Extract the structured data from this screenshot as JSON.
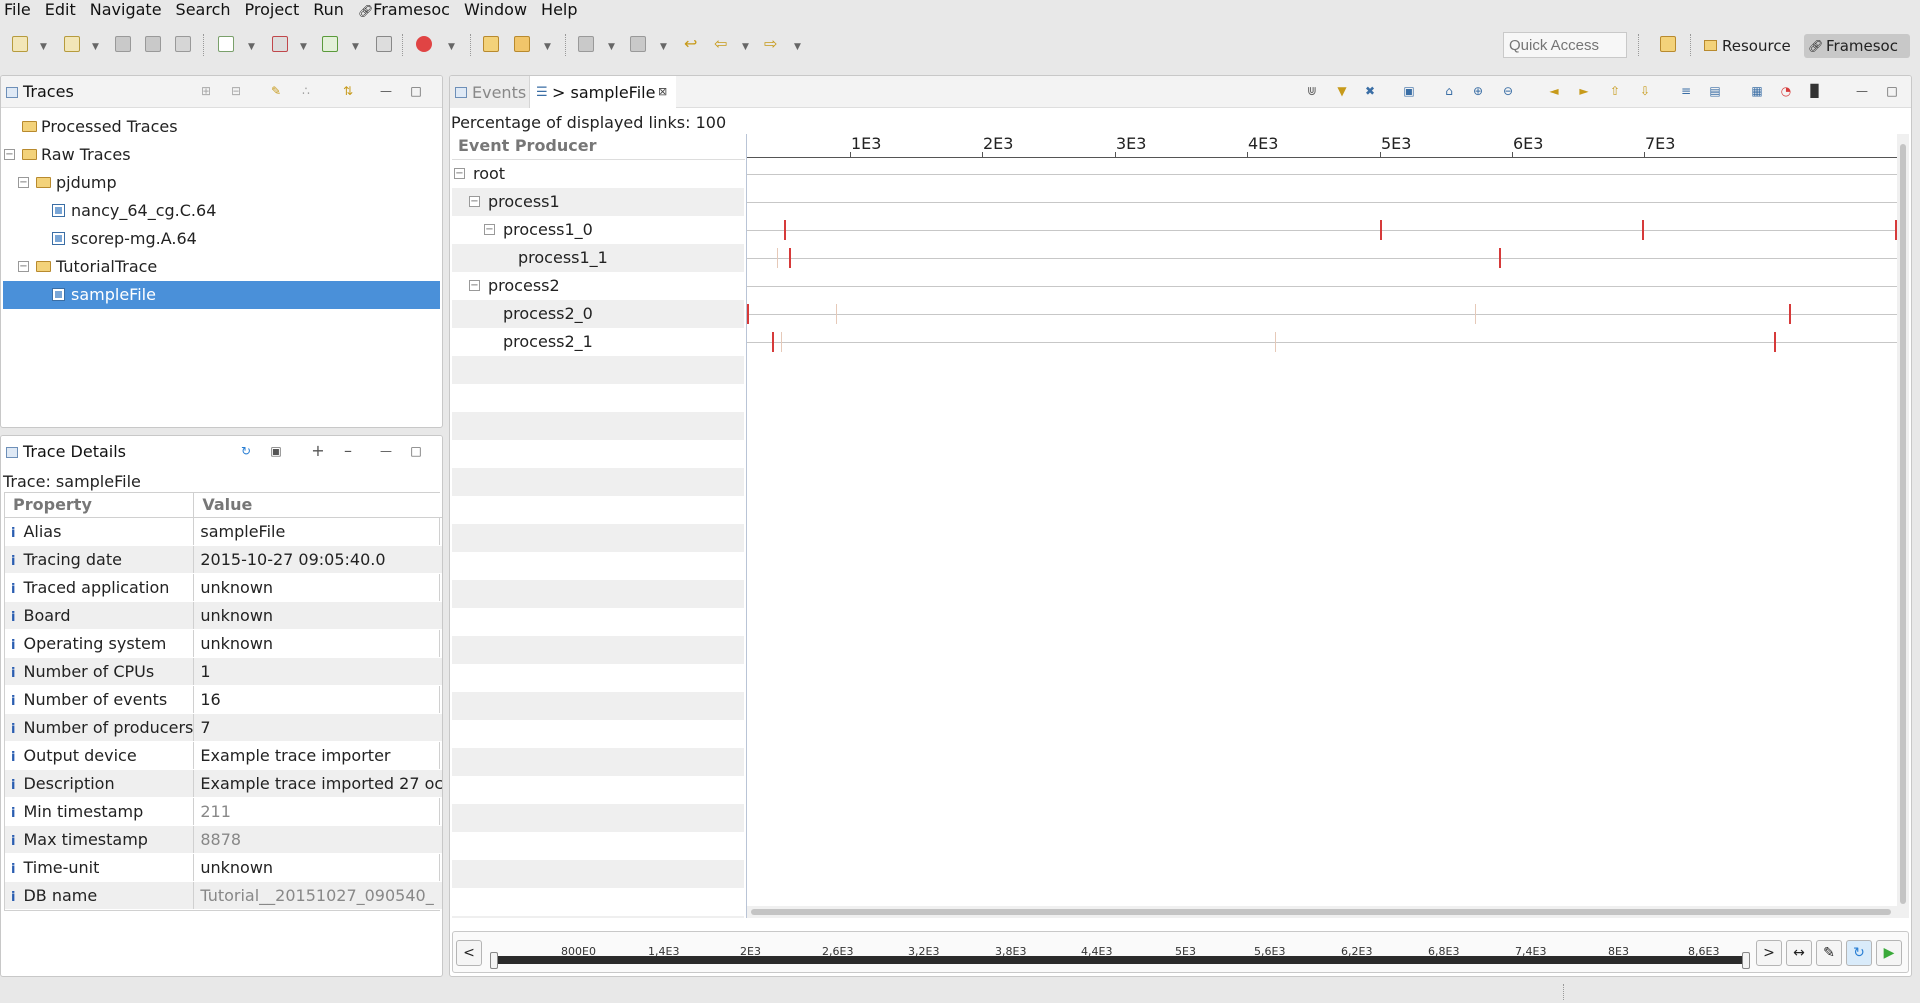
{
  "menu": [
    "File",
    "Edit",
    "Navigate",
    "Search",
    "Project",
    "Run",
    "Framesoc",
    "Window",
    "Help"
  ],
  "quick_access": {
    "placeholder": "Quick Access"
  },
  "perspectives": {
    "resource": "Resource",
    "framesoc": "Framesoc"
  },
  "colors": {
    "selection": "#4a90d9",
    "event_mark": "#d63a3a"
  },
  "traces_panel": {
    "title": "Traces",
    "items": [
      {
        "label": "Processed Traces"
      },
      {
        "label": "Raw Traces"
      },
      {
        "label": "pjdump"
      },
      {
        "label": "nancy_64_cg.C.64"
      },
      {
        "label": "scorep-mg.A.64"
      },
      {
        "label": "TutorialTrace"
      },
      {
        "label": "sampleFile"
      }
    ]
  },
  "details_panel": {
    "title": "Trace Details",
    "trace_label": "Trace: sampleFile",
    "col_property": "Property",
    "col_value": "Value",
    "rows": [
      {
        "k": "Alias",
        "v": "sampleFile"
      },
      {
        "k": "Tracing date",
        "v": "2015-10-27 09:05:40.0"
      },
      {
        "k": "Traced application",
        "v": "unknown"
      },
      {
        "k": "Board",
        "v": "unknown"
      },
      {
        "k": "Operating system",
        "v": "unknown"
      },
      {
        "k": "Number of CPUs",
        "v": "1"
      },
      {
        "k": "Number of events",
        "v": "16"
      },
      {
        "k": "Number of producers",
        "v": "7"
      },
      {
        "k": "Output device",
        "v": "Example trace importer"
      },
      {
        "k": "Description",
        "v": "Example trace imported 27 oc"
      },
      {
        "k": "Min timestamp",
        "v": "211"
      },
      {
        "k": "Max timestamp",
        "v": "8878"
      },
      {
        "k": "Time-unit",
        "v": "unknown"
      },
      {
        "k": "DB name",
        "v": "Tutorial__20151027_090540_"
      }
    ]
  },
  "editor": {
    "tab_events": "Events",
    "tab_active": "> sampleFile",
    "percentage": "Percentage of displayed links: 100.(",
    "producer_header": "Event Producer",
    "producers": [
      {
        "label": "root"
      },
      {
        "label": "process1"
      },
      {
        "label": "process1_0"
      },
      {
        "label": "process1_1"
      },
      {
        "label": "process2"
      },
      {
        "label": "process2_0"
      },
      {
        "label": "process2_1"
      }
    ],
    "top_ticks": [
      "1E3",
      "2E3",
      "3E3",
      "4E3",
      "5E3",
      "6E3",
      "7E3"
    ],
    "bottom_ticks": [
      "800E0",
      "1,4E3",
      "2E3",
      "2,6E3",
      "3,2E3",
      "3,8E3",
      "4,4E3",
      "5E3",
      "5,6E3",
      "6,2E3",
      "6,8E3",
      "7,4E3",
      "8E3",
      "8,6E3"
    ],
    "range_prev": "<",
    "range_next": ">"
  }
}
